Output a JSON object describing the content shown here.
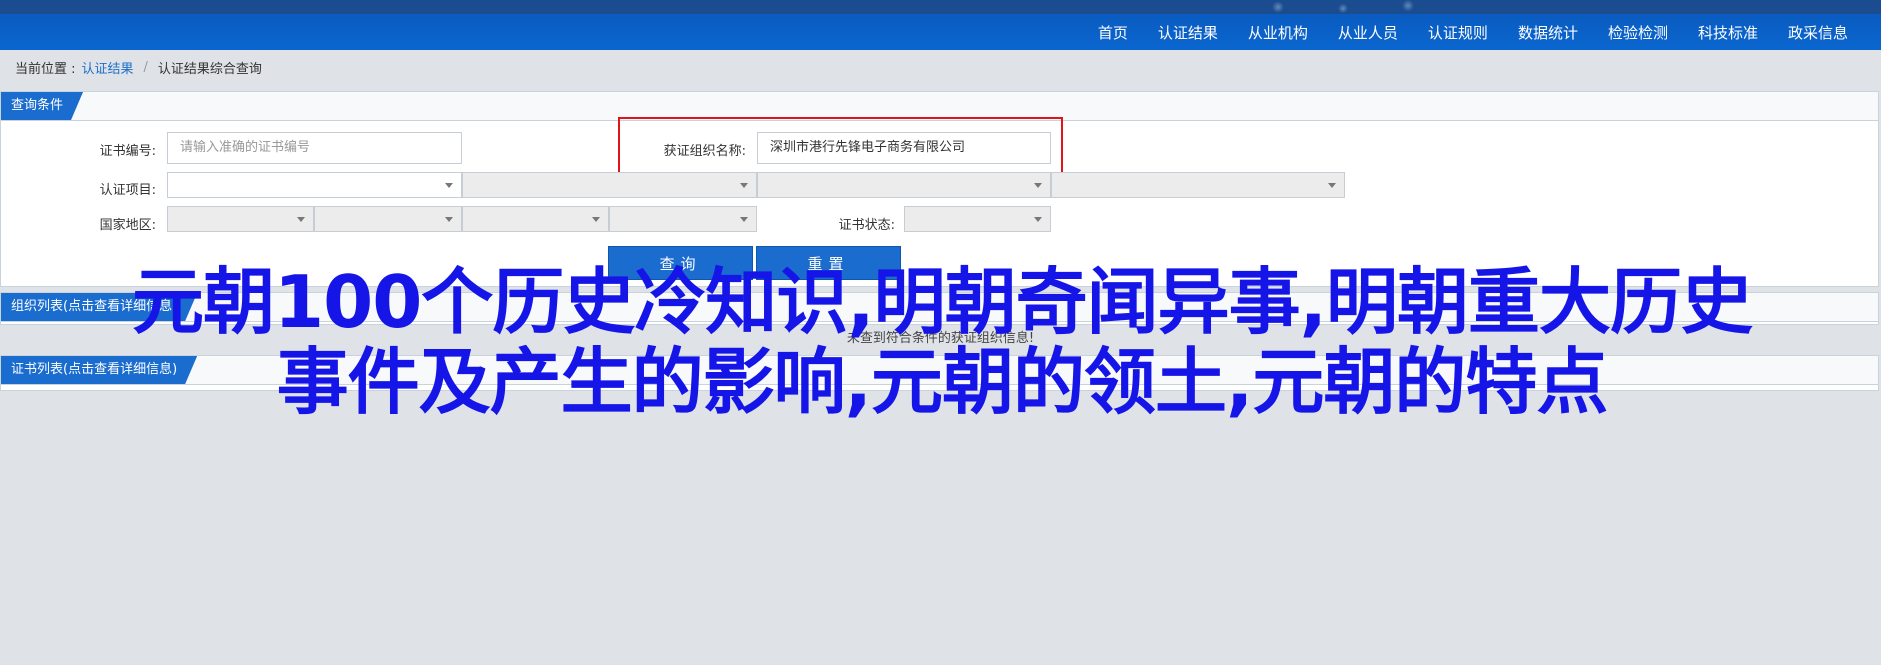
{
  "nav": {
    "items": [
      "首页",
      "认证结果",
      "从业机构",
      "从业人员",
      "认证规则",
      "数据统计",
      "检验检测",
      "科技标准",
      "政采信息"
    ]
  },
  "breadcrumb": {
    "label": "当前位置 :",
    "link": "认证结果",
    "separator": "/",
    "current": "认证结果综合查询"
  },
  "query_panel": {
    "title": "查询条件",
    "cert_no_label": "证书编号:",
    "cert_no_placeholder": "请输入准确的证书编号",
    "org_name_label": "获证组织名称:",
    "org_name_value": "深圳市港行先锋电子商务有限公司",
    "project_label": "认证项目:",
    "region_label": "国家地区:",
    "status_label": "证书状态:",
    "search_button": "查询",
    "reset_button": "重置"
  },
  "org_panel": {
    "title": "组织列表(点击查看详细信息)",
    "empty_message": "未查到符合条件的获证组织信息!"
  },
  "cert_panel": {
    "title": "证书列表(点击查看详细信息)"
  },
  "overlay": {
    "line1": "元朝100个历史冷知识,明朝奇闻异事,明朝重大历史",
    "line2": "事件及产生的影响,元朝的领土,元朝的特点"
  },
  "colors": {
    "nav_blue": "#0a66cf",
    "tab_blue": "#1a6ccf",
    "highlight_red": "#e0141a",
    "overlay_blue": "#1515e8"
  }
}
